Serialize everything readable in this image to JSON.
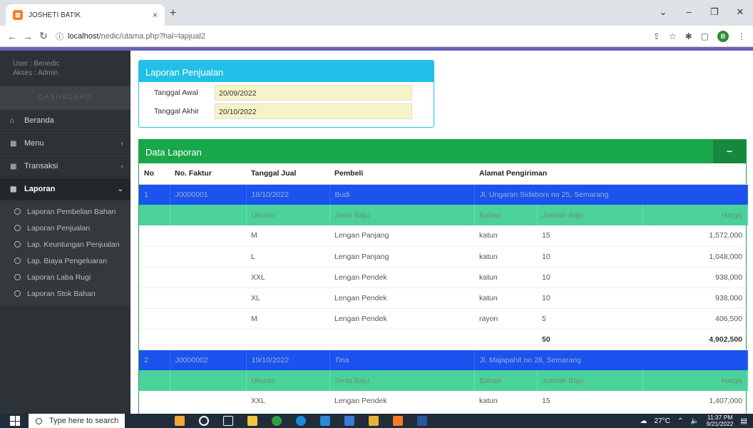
{
  "browser": {
    "tab_title": "JOSHETI BATIK",
    "tab_close": "×",
    "new_tab": "+",
    "url_host": "localhost",
    "url_path": "/nedic/utama.php?hal=lapjual2",
    "profile_initial": "B"
  },
  "sidebar": {
    "user_line": "User  : Benedic",
    "access_line": "Akses : Admin",
    "dashboard_heading": "DASHBOARD",
    "items": [
      {
        "label": "Beranda",
        "icon": "home-icon"
      },
      {
        "label": "Menu",
        "icon": "table-icon"
      },
      {
        "label": "Transaksi",
        "icon": "table-icon"
      },
      {
        "label": "Laporan",
        "icon": "table-icon"
      }
    ],
    "submenu": [
      "Laporan Pembelian Bahan",
      "Laporan Penjualan",
      "Lap. Keuntungan Penjualan",
      "Lap. Biaya Pengeluaran",
      "Laporan Laba Rugi",
      "Laporan Stok Bahan"
    ]
  },
  "report": {
    "title": "Laporan Penjualan",
    "start_label": "Tanggal Awal",
    "start_value": "20/09/2022",
    "end_label": "Tanggal Akhir",
    "end_value": "20/10/2022"
  },
  "data_box": {
    "title": "Data Laporan",
    "minimize": "−",
    "columns": [
      "No",
      "No. Faktur",
      "Tanggal Jual",
      "Pembeli",
      "Alamat Pengiriman"
    ],
    "sub_columns": [
      "Ukuran",
      "Jenis Baju",
      "Bahan",
      "Jumlah Baju",
      "Harga"
    ],
    "orders": [
      {
        "no": "1",
        "invoice": "J0000001",
        "date": "18/10/2022",
        "buyer": "Budi",
        "address": "Jl. Ungaran Sidaboni no 25, Semarang",
        "items": [
          {
            "size": "M",
            "type": "Lengan Panjang",
            "material": "katun",
            "qty": "15",
            "price": "1,572,000"
          },
          {
            "size": "L",
            "type": "Lengan Panjang",
            "material": "katun",
            "qty": "10",
            "price": "1,048,000"
          },
          {
            "size": "XXL",
            "type": "Lengan Pendek",
            "material": "katun",
            "qty": "10",
            "price": "938,000"
          },
          {
            "size": "XL",
            "type": "Lengan Pendek",
            "material": "katun",
            "qty": "10",
            "price": "938,000"
          },
          {
            "size": "M",
            "type": "Lengan Pendek",
            "material": "rayon",
            "qty": "5",
            "price": "406,500"
          }
        ],
        "total_qty": "50",
        "total_price": "4,902,500"
      },
      {
        "no": "2",
        "invoice": "J0000002",
        "date": "19/10/2022",
        "buyer": "Tina",
        "address": "Jl. Majapahit no 28, Semarang",
        "items": [
          {
            "size": "XXL",
            "type": "Lengan Pendek",
            "material": "katun",
            "qty": "15",
            "price": "1,407,000"
          }
        ]
      }
    ]
  },
  "taskbar": {
    "search_placeholder": "Type here to search",
    "weather": "27°C",
    "time": "11:37 PM",
    "date": "9/21/2022"
  }
}
